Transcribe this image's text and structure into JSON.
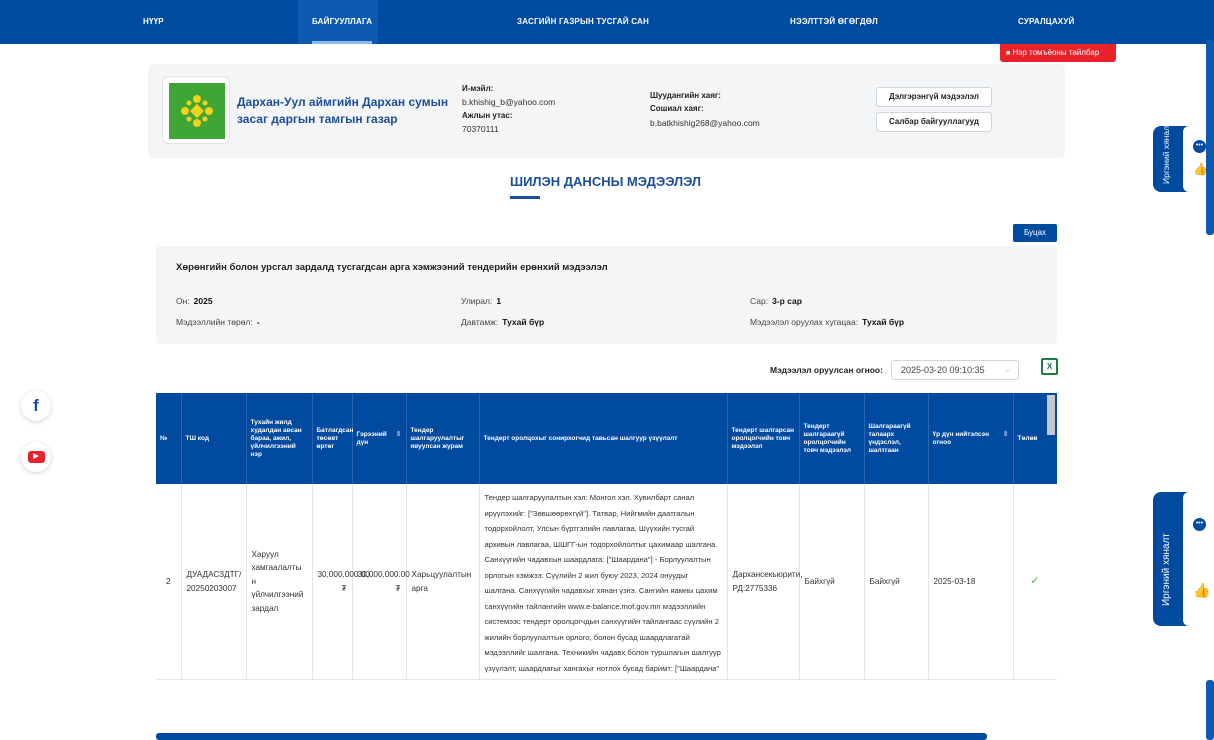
{
  "nav": {
    "items": [
      "НҮҮР",
      "БАЙГУУЛЛАГА",
      "ЗАСГИЙН ГАЗРЫН ТУСГАЙ САН",
      "НЭЭЛТТЭЙ ӨГӨГДӨЛ",
      "СУРАЛЦАХУЙ"
    ],
    "active_index": 1
  },
  "legend_button": "Нэр томъёоны тайлбар",
  "org": {
    "name": "Дархан-Уул аймгийн Дархан сумын засаг даргын тамгын газар",
    "email_label": "И-мэйл:",
    "email_value": "b.khishig_b@yahoo.com",
    "phone_label": "Ажлын утас:",
    "phone_value": "70370111",
    "complaint_label": "Шуудангийн хаяг:",
    "social_label": "Сошиал хаяг:",
    "social_value": "b.batkhishig268@yahoo.com",
    "detail_button": "Дэлгэрэнгүй мэдээлэл",
    "branch_button": "Салбар байгууллагууд"
  },
  "section_title": "ШИЛЭН ДАНСНЫ МЭДЭЭЛЭЛ",
  "back_button": "Буцах",
  "panel": {
    "heading": "Хөрөнгийн болон урсгал зардалд тусгагдсан арга хэмжээний тендерийн ерөнхий мэдээлэл",
    "year_label": "Он:",
    "year_value": "2025",
    "quarter_label": "Улирал:",
    "quarter_value": "1",
    "month_label": "Сар:",
    "month_value": "3-р сар",
    "type_label": "Мэдээллийн төрөл:",
    "type_value": "-",
    "frequency_label": "Давтамж:",
    "frequency_value": "Тухай бүр",
    "deadline_label": "Мэдээлэл оруулах хугацаа:",
    "deadline_value": "Тухай бүр"
  },
  "date_filter": {
    "label": "Мэдээлэл оруулсан огноо:",
    "value": "2025-03-20 09:10:35"
  },
  "excel_icon": "excel-icon",
  "table": {
    "headers": [
      "№",
      "ТШ код",
      "Тухайн жилд худалдан авсан бараа, ажил, үйлчилгээний нэр",
      "Батлагдсан төсөвт өртөг",
      "Гэрээний дүн",
      "Тендер шалгаруулалтыг явуулсан журам",
      "Тендерт оролцохыг сонирхогчид тавьсан шалгуур үзүүлэлт",
      "Тендерт шалгарсан оролцогчийн товч мэдээлэл",
      "Тендерт шалгараагүй оролцогчийн товч мэдээлэл",
      "Шалгараагүй талаарх үндэслэл, шалтгаан",
      "Үр дүн нийтэлсэн огноо",
      "Төлөв"
    ],
    "rows": [
      {
        "no": "2",
        "code": "ДУАДАСЗДТГ/ 20250203007",
        "name": "Харуул хамгаалалты н үйлчилгээний зардал",
        "budget": "30,000,000.00 ₮",
        "contract": "30,000,000.00 ₮",
        "procedure": "Харьцуулалтын арга",
        "criteria": "Тендер шалгаруулалтын хэл: Монгол хэл. Хувилбарт санал ирүүлэхийг: [\"Зөвшөөрөхгүй\"]. Татвар, Нийгмийн даатгалын тодорхойлолт, Улсын бүртгэлийн лавлагаа, Шүүхийн тусгай архивын лавлагаа, ШШГГ-ын тодорхойлолтыг цахимаар шалгана. Санхүүгийн чадавхын шаардлага: [\"Шаардана\"] - Борлуулалтын орлогын хэмжээ: Сүүлийн 2 жил буюу 2023, 2024 онуудыг шалгана. Санхүүгийн чадавхыг хянан үзнэ. Сангийн яамны цахим санхүүгийн тайлангийн www.e-balance.mof.gov.mn мэдээллийн системээс тендерт оролцогчдын санхүүгийн тайлангаас сүүлийн 2 жилийн борлуулалтын орлого, болон бусад шаардлагатай мэдээллийг шалгана. Техникийн чадавх болон туршлагын шалгуур үзүүлэлт, шаардлагыг хангахыг нотлох бусад баримт: [\"Шаардана\"",
        "winner": "Дархансекьюрити, РД:2775336",
        "loser": "Байхгүй",
        "reason": "Байхгүй",
        "date": "2025-03-18",
        "status": "✓"
      }
    ]
  },
  "social": {
    "facebook": "f",
    "youtube": "▶"
  },
  "feedback": {
    "label": "Иргэний хяналт"
  },
  "colors": {
    "primary": "#004a9f",
    "accent_red": "#e8222b",
    "success": "#45b649"
  }
}
